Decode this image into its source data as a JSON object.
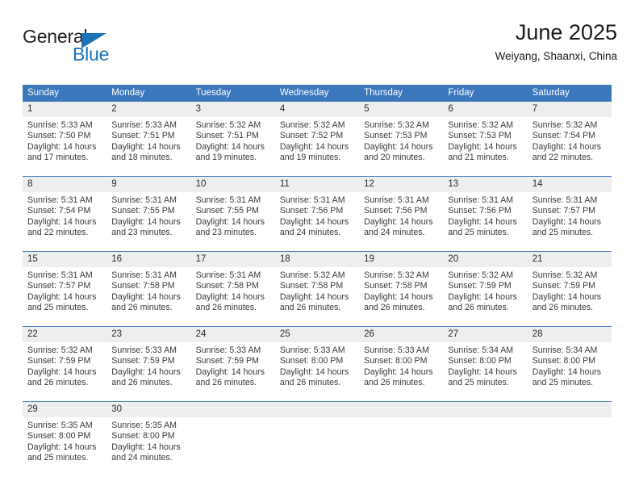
{
  "brand": {
    "name_top": "General",
    "name_bottom": "Blue",
    "triangle_icon": "triangle-right-icon",
    "accent_color": "#1b72b8"
  },
  "header": {
    "title": "June 2025",
    "subtitle": "Weiyang, Shaanxi, China"
  },
  "theme": {
    "header_bg": "#3b77bc",
    "daynum_bg": "#eeeeee",
    "separator": "#4a7fbe",
    "text": "#3a3a3a"
  },
  "calendar": {
    "weekdays": [
      "Sunday",
      "Monday",
      "Tuesday",
      "Wednesday",
      "Thursday",
      "Friday",
      "Saturday"
    ],
    "weeks": [
      {
        "days": [
          {
            "num": "1",
            "sunrise": "Sunrise: 5:33 AM",
            "sunset": "Sunset: 7:50 PM",
            "daylight1": "Daylight: 14 hours",
            "daylight2": "and 17 minutes."
          },
          {
            "num": "2",
            "sunrise": "Sunrise: 5:33 AM",
            "sunset": "Sunset: 7:51 PM",
            "daylight1": "Daylight: 14 hours",
            "daylight2": "and 18 minutes."
          },
          {
            "num": "3",
            "sunrise": "Sunrise: 5:32 AM",
            "sunset": "Sunset: 7:51 PM",
            "daylight1": "Daylight: 14 hours",
            "daylight2": "and 19 minutes."
          },
          {
            "num": "4",
            "sunrise": "Sunrise: 5:32 AM",
            "sunset": "Sunset: 7:52 PM",
            "daylight1": "Daylight: 14 hours",
            "daylight2": "and 19 minutes."
          },
          {
            "num": "5",
            "sunrise": "Sunrise: 5:32 AM",
            "sunset": "Sunset: 7:53 PM",
            "daylight1": "Daylight: 14 hours",
            "daylight2": "and 20 minutes."
          },
          {
            "num": "6",
            "sunrise": "Sunrise: 5:32 AM",
            "sunset": "Sunset: 7:53 PM",
            "daylight1": "Daylight: 14 hours",
            "daylight2": "and 21 minutes."
          },
          {
            "num": "7",
            "sunrise": "Sunrise: 5:32 AM",
            "sunset": "Sunset: 7:54 PM",
            "daylight1": "Daylight: 14 hours",
            "daylight2": "and 22 minutes."
          }
        ]
      },
      {
        "days": [
          {
            "num": "8",
            "sunrise": "Sunrise: 5:31 AM",
            "sunset": "Sunset: 7:54 PM",
            "daylight1": "Daylight: 14 hours",
            "daylight2": "and 22 minutes."
          },
          {
            "num": "9",
            "sunrise": "Sunrise: 5:31 AM",
            "sunset": "Sunset: 7:55 PM",
            "daylight1": "Daylight: 14 hours",
            "daylight2": "and 23 minutes."
          },
          {
            "num": "10",
            "sunrise": "Sunrise: 5:31 AM",
            "sunset": "Sunset: 7:55 PM",
            "daylight1": "Daylight: 14 hours",
            "daylight2": "and 23 minutes."
          },
          {
            "num": "11",
            "sunrise": "Sunrise: 5:31 AM",
            "sunset": "Sunset: 7:56 PM",
            "daylight1": "Daylight: 14 hours",
            "daylight2": "and 24 minutes."
          },
          {
            "num": "12",
            "sunrise": "Sunrise: 5:31 AM",
            "sunset": "Sunset: 7:56 PM",
            "daylight1": "Daylight: 14 hours",
            "daylight2": "and 24 minutes."
          },
          {
            "num": "13",
            "sunrise": "Sunrise: 5:31 AM",
            "sunset": "Sunset: 7:56 PM",
            "daylight1": "Daylight: 14 hours",
            "daylight2": "and 25 minutes."
          },
          {
            "num": "14",
            "sunrise": "Sunrise: 5:31 AM",
            "sunset": "Sunset: 7:57 PM",
            "daylight1": "Daylight: 14 hours",
            "daylight2": "and 25 minutes."
          }
        ]
      },
      {
        "days": [
          {
            "num": "15",
            "sunrise": "Sunrise: 5:31 AM",
            "sunset": "Sunset: 7:57 PM",
            "daylight1": "Daylight: 14 hours",
            "daylight2": "and 25 minutes."
          },
          {
            "num": "16",
            "sunrise": "Sunrise: 5:31 AM",
            "sunset": "Sunset: 7:58 PM",
            "daylight1": "Daylight: 14 hours",
            "daylight2": "and 26 minutes."
          },
          {
            "num": "17",
            "sunrise": "Sunrise: 5:31 AM",
            "sunset": "Sunset: 7:58 PM",
            "daylight1": "Daylight: 14 hours",
            "daylight2": "and 26 minutes."
          },
          {
            "num": "18",
            "sunrise": "Sunrise: 5:32 AM",
            "sunset": "Sunset: 7:58 PM",
            "daylight1": "Daylight: 14 hours",
            "daylight2": "and 26 minutes."
          },
          {
            "num": "19",
            "sunrise": "Sunrise: 5:32 AM",
            "sunset": "Sunset: 7:58 PM",
            "daylight1": "Daylight: 14 hours",
            "daylight2": "and 26 minutes."
          },
          {
            "num": "20",
            "sunrise": "Sunrise: 5:32 AM",
            "sunset": "Sunset: 7:59 PM",
            "daylight1": "Daylight: 14 hours",
            "daylight2": "and 26 minutes."
          },
          {
            "num": "21",
            "sunrise": "Sunrise: 5:32 AM",
            "sunset": "Sunset: 7:59 PM",
            "daylight1": "Daylight: 14 hours",
            "daylight2": "and 26 minutes."
          }
        ]
      },
      {
        "days": [
          {
            "num": "22",
            "sunrise": "Sunrise: 5:32 AM",
            "sunset": "Sunset: 7:59 PM",
            "daylight1": "Daylight: 14 hours",
            "daylight2": "and 26 minutes."
          },
          {
            "num": "23",
            "sunrise": "Sunrise: 5:33 AM",
            "sunset": "Sunset: 7:59 PM",
            "daylight1": "Daylight: 14 hours",
            "daylight2": "and 26 minutes."
          },
          {
            "num": "24",
            "sunrise": "Sunrise: 5:33 AM",
            "sunset": "Sunset: 7:59 PM",
            "daylight1": "Daylight: 14 hours",
            "daylight2": "and 26 minutes."
          },
          {
            "num": "25",
            "sunrise": "Sunrise: 5:33 AM",
            "sunset": "Sunset: 8:00 PM",
            "daylight1": "Daylight: 14 hours",
            "daylight2": "and 26 minutes."
          },
          {
            "num": "26",
            "sunrise": "Sunrise: 5:33 AM",
            "sunset": "Sunset: 8:00 PM",
            "daylight1": "Daylight: 14 hours",
            "daylight2": "and 26 minutes."
          },
          {
            "num": "27",
            "sunrise": "Sunrise: 5:34 AM",
            "sunset": "Sunset: 8:00 PM",
            "daylight1": "Daylight: 14 hours",
            "daylight2": "and 25 minutes."
          },
          {
            "num": "28",
            "sunrise": "Sunrise: 5:34 AM",
            "sunset": "Sunset: 8:00 PM",
            "daylight1": "Daylight: 14 hours",
            "daylight2": "and 25 minutes."
          }
        ]
      },
      {
        "days": [
          {
            "num": "29",
            "sunrise": "Sunrise: 5:35 AM",
            "sunset": "Sunset: 8:00 PM",
            "daylight1": "Daylight: 14 hours",
            "daylight2": "and 25 minutes."
          },
          {
            "num": "30",
            "sunrise": "Sunrise: 5:35 AM",
            "sunset": "Sunset: 8:00 PM",
            "daylight1": "Daylight: 14 hours",
            "daylight2": "and 24 minutes."
          },
          {
            "num": "",
            "sunrise": "",
            "sunset": "",
            "daylight1": "",
            "daylight2": ""
          },
          {
            "num": "",
            "sunrise": "",
            "sunset": "",
            "daylight1": "",
            "daylight2": ""
          },
          {
            "num": "",
            "sunrise": "",
            "sunset": "",
            "daylight1": "",
            "daylight2": ""
          },
          {
            "num": "",
            "sunrise": "",
            "sunset": "",
            "daylight1": "",
            "daylight2": ""
          },
          {
            "num": "",
            "sunrise": "",
            "sunset": "",
            "daylight1": "",
            "daylight2": ""
          }
        ]
      }
    ]
  }
}
